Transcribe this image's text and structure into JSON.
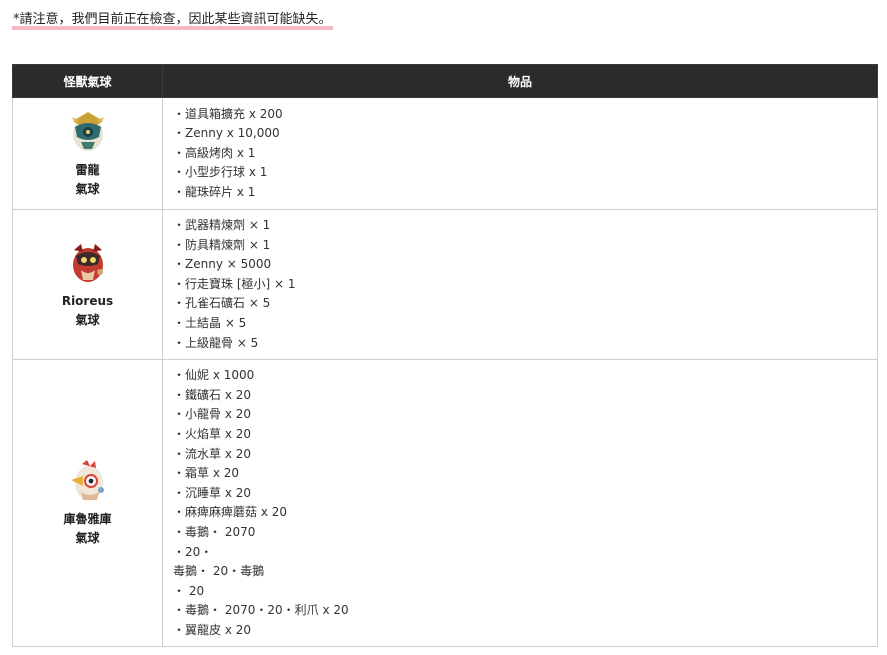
{
  "notice": "*請注意，我們目前正在檢查，因此某些資訊可能缺失。",
  "table": {
    "headers": {
      "monster": "怪獸氣球",
      "items": "物品"
    },
    "rows": [
      {
        "name_line1": "雷龍",
        "name_line2": "氣球",
        "icon": "zinogre-balloon-icon",
        "items": [
          "・道具箱擴充 x 200",
          "・Zenny x 10,000",
          "・高級烤肉 x 1",
          "・小型步行球 x 1",
          "・龍珠碎片 x 1"
        ]
      },
      {
        "name_line1": "Rioreus",
        "name_line2": "氣球",
        "icon": "rathalos-balloon-icon",
        "items": [
          "・武器精煉劑 × 1",
          "・防具精煉劑 × 1",
          "・Zenny × 5000",
          "・行走寶珠 [極小] × 1",
          "・孔雀石礦石 × 5",
          "・土結晶 × 5",
          "・上級龍骨 × 5"
        ]
      },
      {
        "name_line1": "庫魯雅庫",
        "name_line2": "氣球",
        "icon": "kulu-ya-ku-balloon-icon",
        "items": [
          "・仙妮 x 1000",
          "・鐵礦石 x 20",
          "・小龍骨 x 20",
          "・火焰草 x 20",
          "・流水草 x 20",
          "・霜草 x 20",
          "・沉睡草 x 20",
          "・麻痺麻痺蘑菇 x 20",
          "・毒鵝・ 2070",
          "・20・",
          "毒鵝・ 20・毒鵝",
          "・ 20",
          "・毒鵝・ 2070・20・利爪 x 20",
          "・翼龍皮 x 20"
        ]
      }
    ]
  },
  "colors": {
    "header_bg": "#2b2b2b",
    "header_text": "#ffffff",
    "highlight": "#f6b8c4",
    "border": "#cfcfcf"
  }
}
